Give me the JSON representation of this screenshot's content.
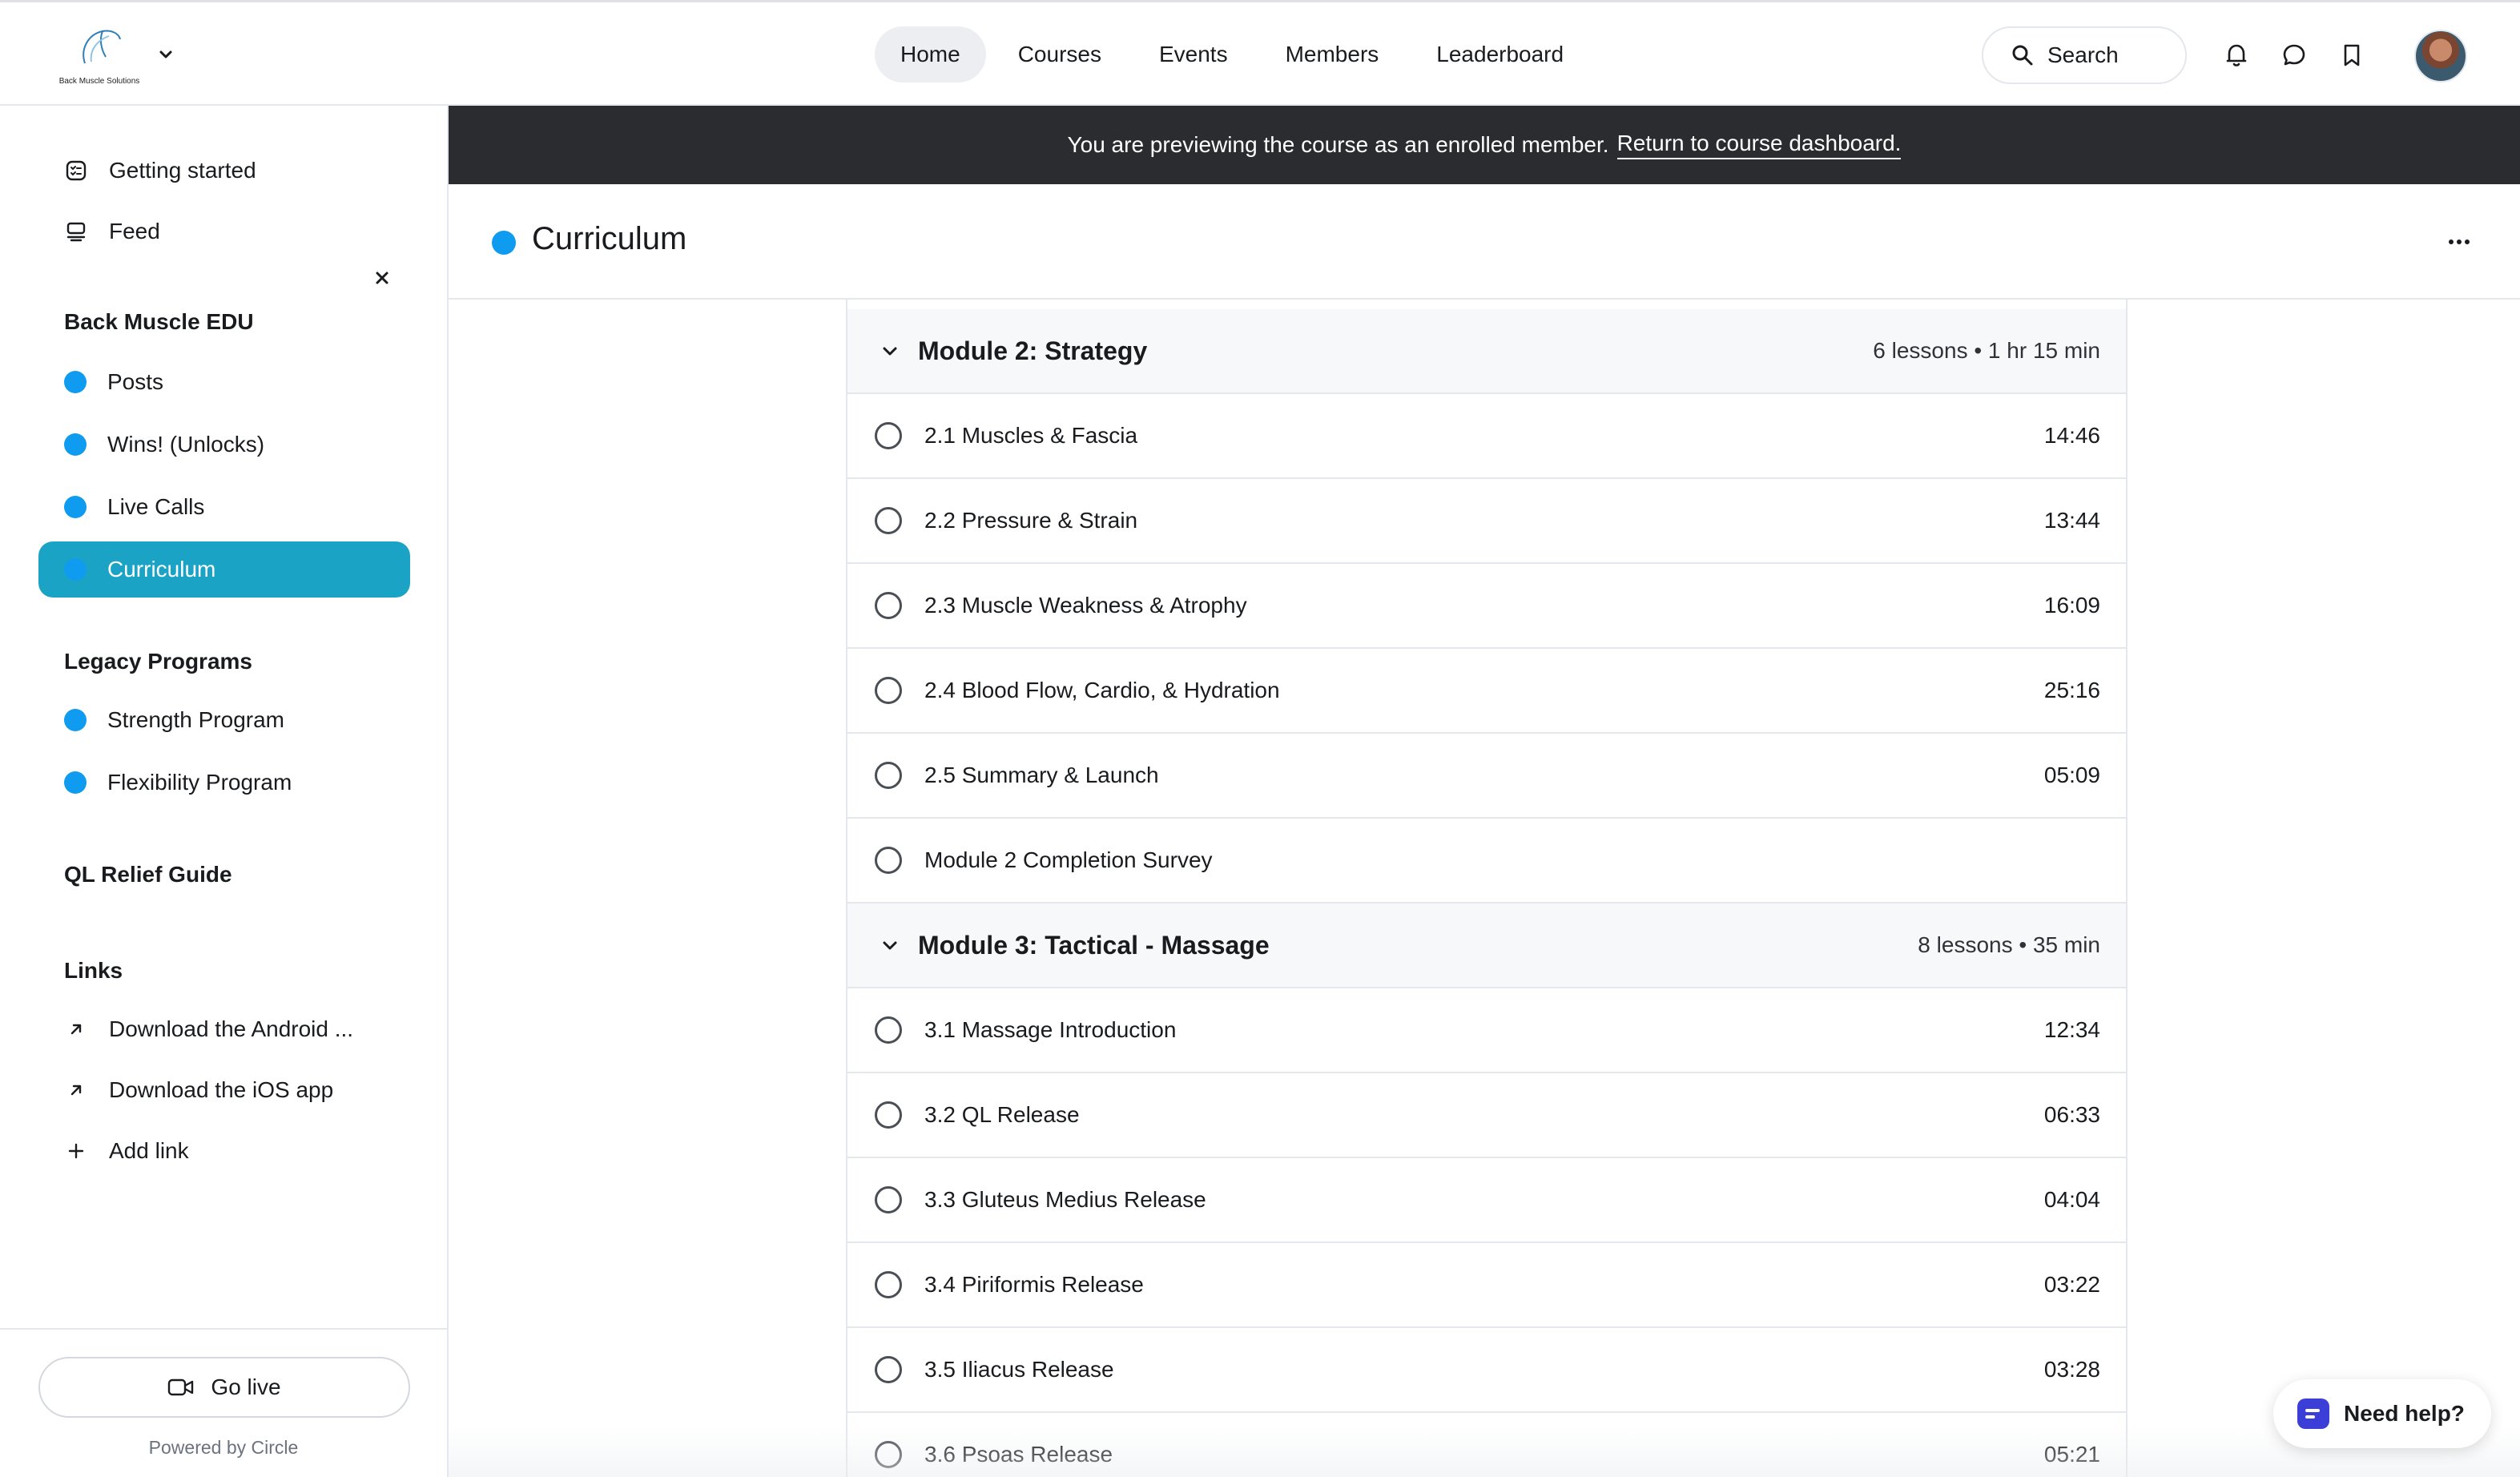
{
  "brand": {
    "logo_text": "Back Muscle Solutions"
  },
  "topnav": {
    "items": [
      {
        "label": "Home",
        "active": true
      },
      {
        "label": "Courses",
        "active": false
      },
      {
        "label": "Events",
        "active": false
      },
      {
        "label": "Members",
        "active": false
      },
      {
        "label": "Leaderboard",
        "active": false
      }
    ],
    "search_label": "Search"
  },
  "sidebar": {
    "getting_started": "Getting started",
    "feed": "Feed",
    "section_1": {
      "heading": "Back Muscle EDU",
      "items": [
        "Posts",
        "Wins! (Unlocks)",
        "Live Calls",
        "Curriculum"
      ],
      "active": "Curriculum"
    },
    "section_2": {
      "heading": "Legacy Programs",
      "items": [
        "Strength Program",
        "Flexibility Program"
      ]
    },
    "section_3": {
      "heading": "QL Relief Guide"
    },
    "links": {
      "heading": "Links",
      "items": [
        "Download the Android ...",
        "Download the iOS app"
      ],
      "add_link": "Add link"
    },
    "go_live": "Go live",
    "powered_by": "Powered by Circle"
  },
  "banner": {
    "text": "You are previewing the course as an enrolled member.",
    "link": "Return to course dashboard."
  },
  "page": {
    "title": "Curriculum"
  },
  "modules": [
    {
      "title": "Module 2: Strategy",
      "meta": "6 lessons • 1 hr 15 min",
      "lessons": [
        {
          "title": "2.1 Muscles & Fascia",
          "duration": "14:46"
        },
        {
          "title": "2.2 Pressure & Strain",
          "duration": "13:44"
        },
        {
          "title": "2.3 Muscle Weakness & Atrophy",
          "duration": "16:09"
        },
        {
          "title": "2.4 Blood Flow, Cardio, & Hydration",
          "duration": "25:16"
        },
        {
          "title": "2.5 Summary & Launch",
          "duration": "05:09"
        },
        {
          "title": "Module 2 Completion Survey",
          "duration": ""
        }
      ]
    },
    {
      "title": "Module 3: Tactical - Massage",
      "meta": "8 lessons • 35 min",
      "lessons": [
        {
          "title": "3.1 Massage Introduction",
          "duration": "12:34"
        },
        {
          "title": "3.2 QL Release",
          "duration": "06:33"
        },
        {
          "title": "3.3 Gluteus Medius Release",
          "duration": "04:04"
        },
        {
          "title": "3.4 Piriformis Release",
          "duration": "03:22"
        },
        {
          "title": "3.5 Iliacus Release",
          "duration": "03:28"
        },
        {
          "title": "3.6 Psoas Release",
          "duration": "05:21"
        }
      ]
    }
  ],
  "help": {
    "label": "Need help?"
  },
  "colors": {
    "accent": "#1ba3c6",
    "dot": "#0f9cf0",
    "banner": "#2a2c30"
  }
}
